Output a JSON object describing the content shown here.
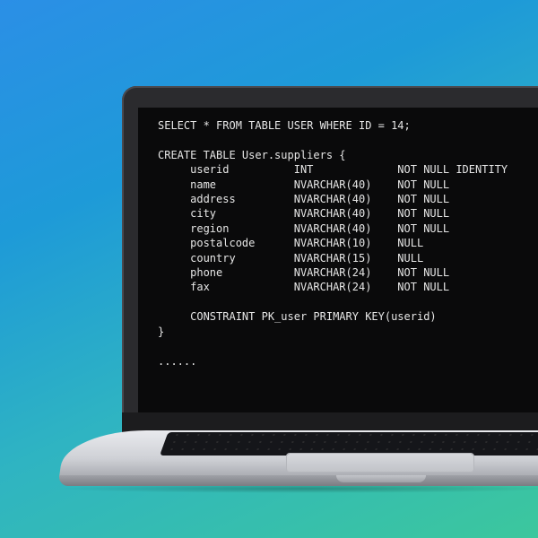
{
  "screen": {
    "code_lines": [
      "SELECT * FROM TABLE USER WHERE ID = 14;",
      "",
      "CREATE TABLE User.suppliers {",
      "     userid          INT             NOT NULL IDENTITY",
      "     name            NVARCHAR(40)    NOT NULL",
      "     address         NVARCHAR(40)    NOT NULL",
      "     city            NVARCHAR(40)    NOT NULL",
      "     region          NVARCHAR(40)    NOT NULL",
      "     postalcode      NVARCHAR(10)    NULL",
      "     country         NVARCHAR(15)    NULL",
      "     phone           NVARCHAR(24)    NOT NULL",
      "     fax             NVARCHAR(24)    NOT NULL",
      "",
      "     CONSTRAINT PK_user PRIMARY KEY(userid)",
      "}",
      "",
      "......"
    ]
  },
  "colors": {
    "background_top": "#2b8fe6",
    "background_bottom": "#3cc79d",
    "screen_bg": "#0a0a0b",
    "code_text": "#e6e6e6",
    "laptop_silver": "#cfd1d6"
  }
}
